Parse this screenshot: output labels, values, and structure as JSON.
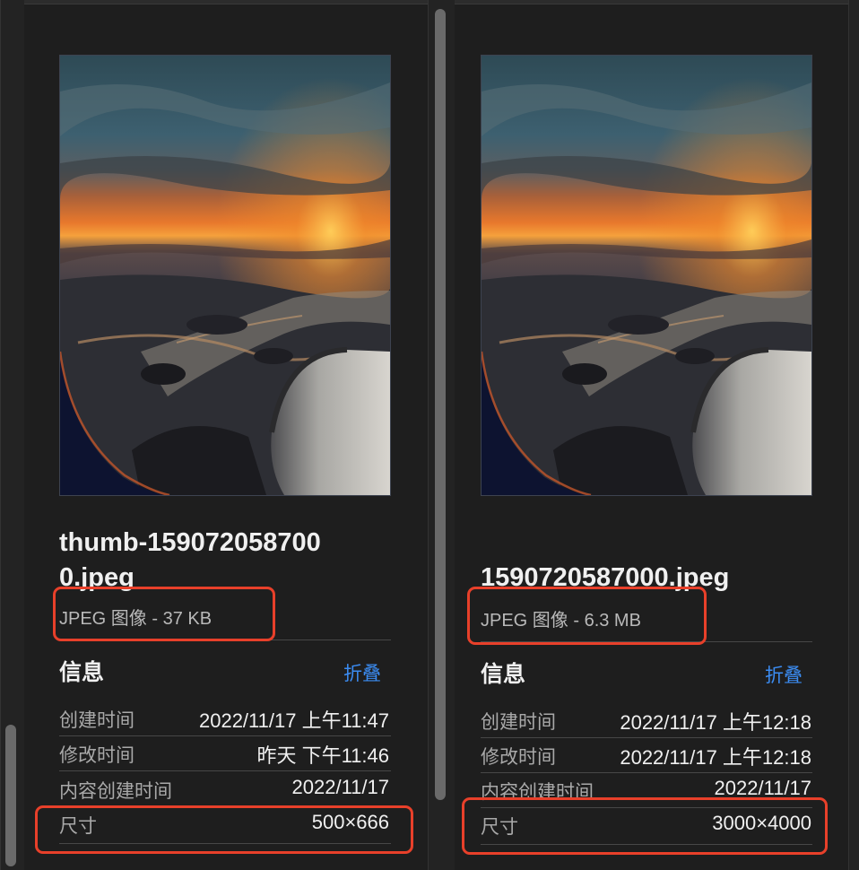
{
  "colors": {
    "accent": "#3b8cf2",
    "highlight_box": "#e8402a",
    "panel_bg": "#1e1e1e",
    "label": "#a9a9a9",
    "value": "#f0f0f0"
  },
  "left_panel": {
    "filename": "thumb-159072058700\n0.jpeg",
    "filetype": "JPEG 图像 - 37 KB",
    "info_title": "信息",
    "collapse_label": "折叠",
    "rows": [
      {
        "label": "创建时间",
        "value": "2022/11/17 上午11:47"
      },
      {
        "label": "修改时间",
        "value": "昨天 下午11:46"
      },
      {
        "label": "内容创建时间",
        "value": "2022/11/17"
      },
      {
        "label": "尺寸",
        "value": "500×666"
      }
    ]
  },
  "right_panel": {
    "filename": "1590720587000.jpeg",
    "filetype": "JPEG 图像 - 6.3 MB",
    "info_title": "信息",
    "collapse_label": "折叠",
    "rows": [
      {
        "label": "创建时间",
        "value": "2022/11/17 上午12:18"
      },
      {
        "label": "修改时间",
        "value": "2022/11/17 上午12:18"
      },
      {
        "label": "内容创建时间",
        "value": "2022/11/17"
      },
      {
        "label": "尺寸",
        "value": "3000×4000"
      }
    ]
  }
}
